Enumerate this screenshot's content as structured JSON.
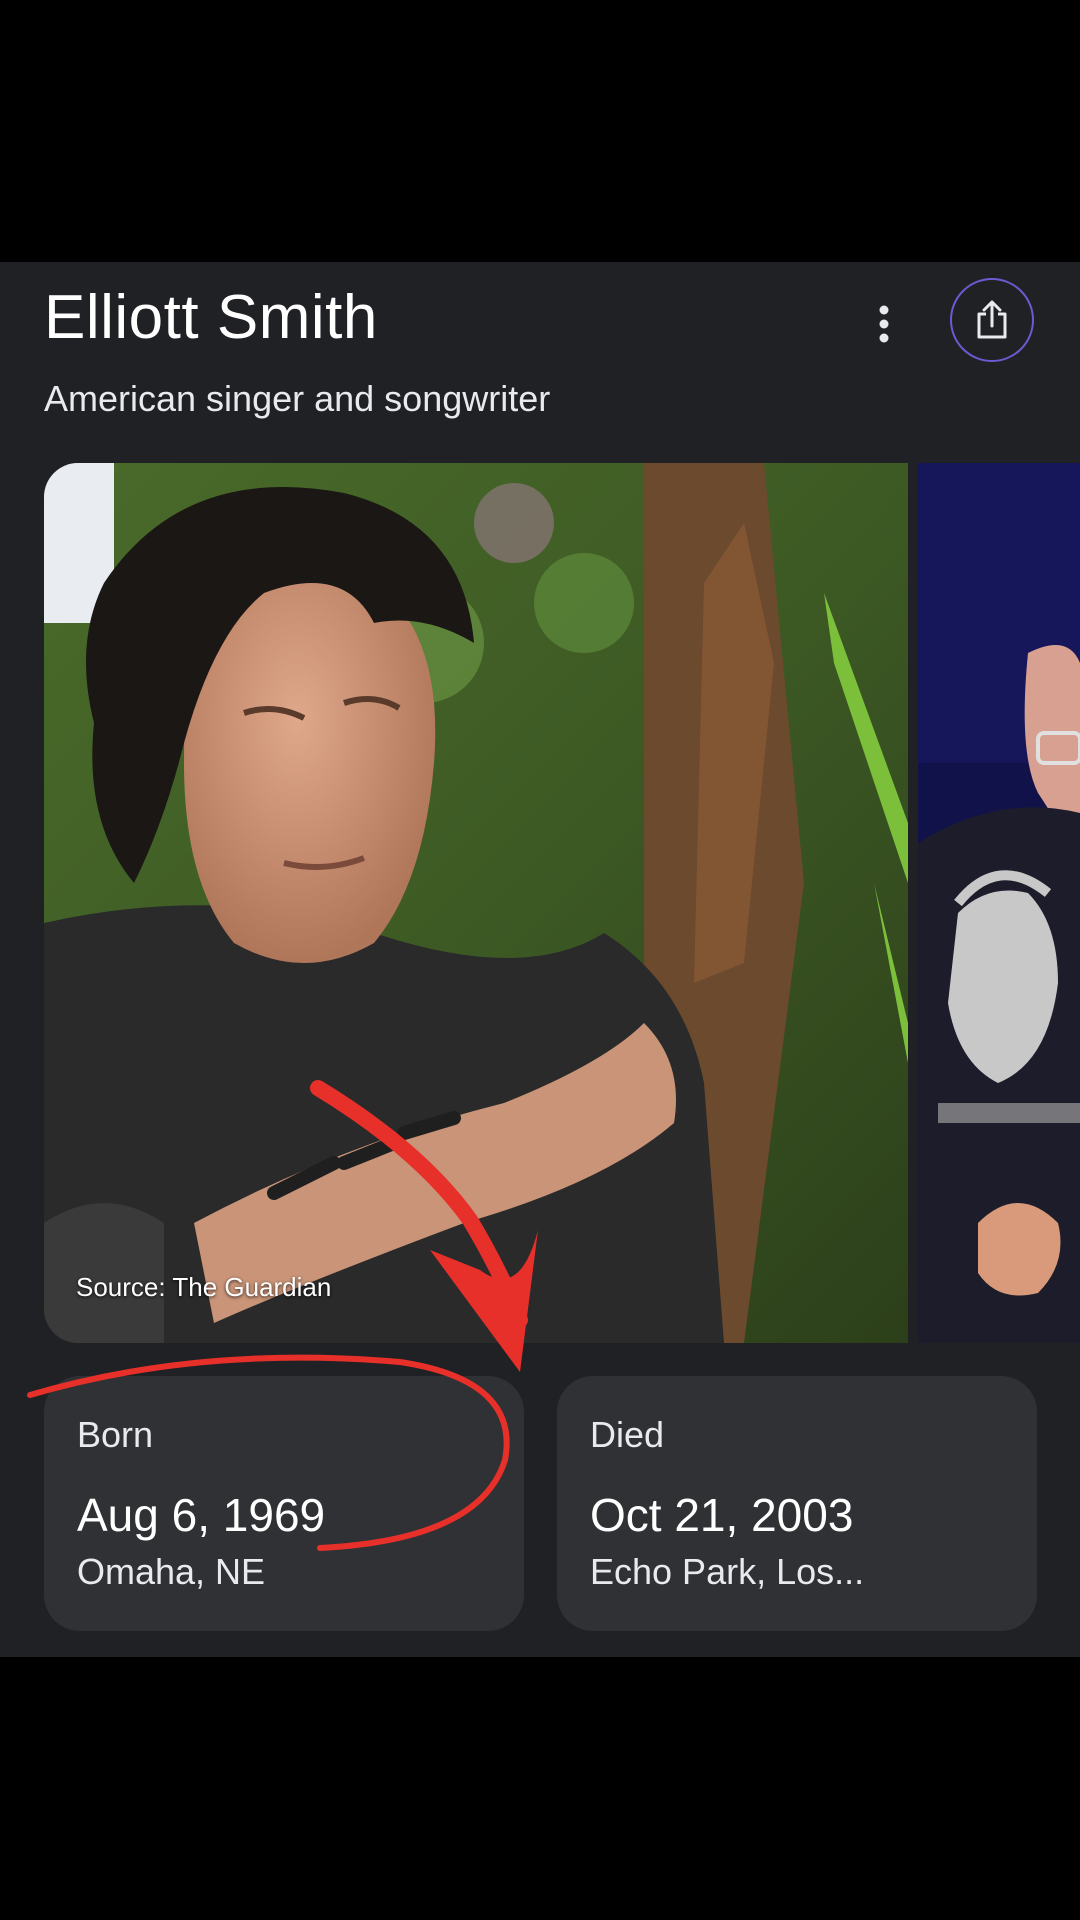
{
  "header": {
    "title": "Elliott Smith",
    "subtitle": "American singer and songwriter",
    "more_icon": "more-vert-icon",
    "share_icon": "share-icon"
  },
  "images": {
    "main_source": "Source: The Guardian"
  },
  "facts": {
    "born": {
      "label": "Born",
      "date": "Aug 6, 1969",
      "place": "Omaha, NE"
    },
    "died": {
      "label": "Died",
      "date": "Oct 21, 2003",
      "place": "Echo Park, Los..."
    }
  },
  "colors": {
    "panel_bg": "#202124",
    "card_bg": "#303134",
    "share_ring": "#6a5bd0",
    "annotation_red": "#e8302a"
  }
}
